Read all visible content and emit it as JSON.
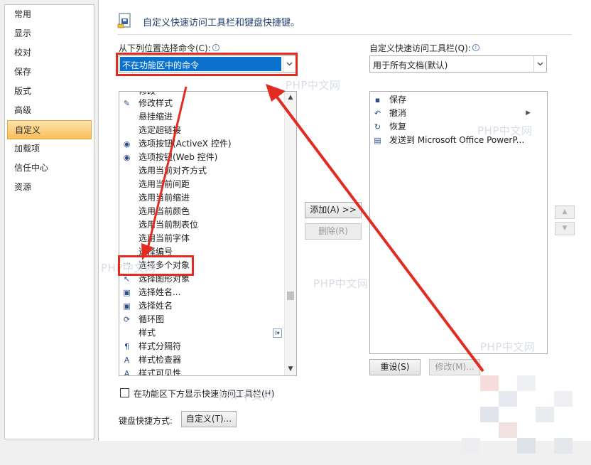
{
  "nav": {
    "items": [
      {
        "label": "常用"
      },
      {
        "label": "显示"
      },
      {
        "label": "校对"
      },
      {
        "label": "保存"
      },
      {
        "label": "版式"
      },
      {
        "label": "高级"
      },
      {
        "label": "自定义"
      },
      {
        "label": "加载项"
      },
      {
        "label": "信任中心"
      },
      {
        "label": "资源"
      }
    ],
    "active": "自定义"
  },
  "header": {
    "title": "自定义快速访问工具栏和键盘快捷键。"
  },
  "choose_from": {
    "label": "从下列位置选择命令(C):",
    "value": "不在功能区中的命令"
  },
  "customize_toolbar": {
    "label": "自定义快速访问工具栏(Q):",
    "value": "用于所有文档(默认)"
  },
  "command_list": {
    "items": [
      {
        "label": "修改样式",
        "icon": "modify-style-icon",
        "glyph": "✎"
      },
      {
        "label": "悬挂缩进",
        "icon": "",
        "glyph": ""
      },
      {
        "label": "选定超链接",
        "icon": "",
        "glyph": ""
      },
      {
        "label": "选项按钮(ActiveX 控件)",
        "icon": "radio-button-icon",
        "glyph": "◉"
      },
      {
        "label": "选项按钮(Web 控件)",
        "icon": "radio-button-icon",
        "glyph": "◉"
      },
      {
        "label": "选用当前对齐方式",
        "icon": "",
        "glyph": ""
      },
      {
        "label": "选用当前间距",
        "icon": "",
        "glyph": ""
      },
      {
        "label": "选用当前缩进",
        "icon": "",
        "glyph": ""
      },
      {
        "label": "选用当前颜色",
        "icon": "",
        "glyph": ""
      },
      {
        "label": "选用当前制表位",
        "icon": "",
        "glyph": ""
      },
      {
        "label": "选用当前字体",
        "icon": "",
        "glyph": ""
      },
      {
        "label": "选择编号",
        "icon": "",
        "glyph": ""
      },
      {
        "label": "选择多个对象",
        "icon": "select-objects-icon",
        "glyph": "⬚"
      },
      {
        "label": "选择图形对象",
        "icon": "pointer-icon",
        "glyph": "↖"
      },
      {
        "label": "选择姓名...",
        "icon": "address-book-icon",
        "glyph": "▣"
      },
      {
        "label": "选择姓名",
        "icon": "address-book-icon",
        "glyph": "▣"
      },
      {
        "label": "循环图",
        "icon": "cycle-diagram-icon",
        "glyph": "⟳"
      },
      {
        "label": "样式",
        "icon": "",
        "glyph": ""
      },
      {
        "label": "样式分隔符",
        "icon": "paragraph-mark-icon",
        "glyph": "¶"
      },
      {
        "label": "样式检查器",
        "icon": "style-inspector-icon",
        "glyph": "A"
      },
      {
        "label": "样式可见性",
        "icon": "style-visibility-icon",
        "glyph": "A"
      }
    ]
  },
  "toolbar_list": {
    "items": [
      {
        "label": "保存",
        "icon": "save-icon",
        "glyph": "▪"
      },
      {
        "label": "撤消",
        "icon": "undo-icon",
        "glyph": "↶"
      },
      {
        "label": "恢复",
        "icon": "redo-icon",
        "glyph": "↻"
      },
      {
        "label": "发送到 Microsoft Office PowerP...",
        "icon": "send-to-powerpoint-icon",
        "glyph": "▤"
      }
    ]
  },
  "buttons": {
    "add": "添加(A) >>",
    "remove": "删除(R)",
    "reset": "重设(S)",
    "modify": "修改(M)...",
    "keyboard_customize": "自定义(T)..."
  },
  "show_below_ribbon": {
    "label": "在功能区下方显示快速访问工具栏(H)",
    "checked": false
  },
  "keyboard": {
    "label": "键盘快捷方式:"
  },
  "watermark": "PHP中文网",
  "colors": {
    "accent": "#0a72cd",
    "highlight": "#e32b22",
    "nav_active": "#f8be5b"
  }
}
